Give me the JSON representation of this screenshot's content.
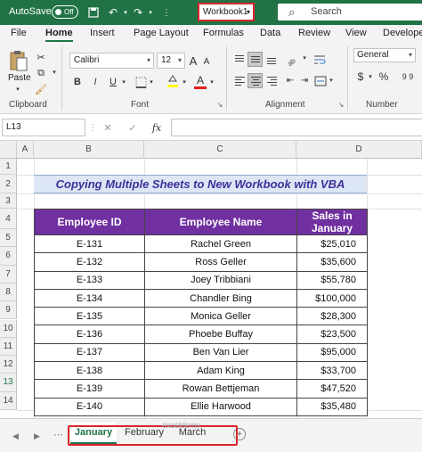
{
  "titlebar": {
    "autosave_label": "AutoSave",
    "toggle_state": "Off",
    "workbook_name": "Workbook1",
    "search_placeholder": "Search"
  },
  "ribbon_tabs": [
    "File",
    "Home",
    "Insert",
    "Page Layout",
    "Formulas",
    "Data",
    "Review",
    "View",
    "Develope"
  ],
  "ribbon": {
    "paste_label": "Paste",
    "clipboard_group": "Clipboard",
    "font_name": "Calibri",
    "font_size": "12",
    "font_group": "Font",
    "bold": "B",
    "italic": "I",
    "underline": "U",
    "grow_font": "A",
    "shrink_font": "A",
    "fill_color_letter": "A",
    "alignment_group": "Alignment",
    "number_format": "General",
    "currency_symbol": "$",
    "percent_symbol": "%",
    "number_group": "Number"
  },
  "formula_bar": {
    "name_box": "L13",
    "cancel_symbol": "✕",
    "enter_symbol": "✓",
    "fx_symbol": "fx",
    "content": ""
  },
  "columns": [
    "A",
    "B",
    "C",
    "D"
  ],
  "rows": [
    "1",
    "2",
    "3",
    "4",
    "5",
    "6",
    "7",
    "8",
    "9",
    "10",
    "11",
    "12",
    "13",
    "14"
  ],
  "sheet_title": "Copying Multiple Sheets to New Workbook with VBA",
  "table": {
    "headers": [
      "Employee ID",
      "Employee Name",
      "Sales in January"
    ],
    "rows": [
      [
        "E-131",
        "Rachel Green",
        "$25,010"
      ],
      [
        "E-132",
        "Ross Geller",
        "$35,600"
      ],
      [
        "E-133",
        "Joey Tribbiani",
        "$55,780"
      ],
      [
        "E-134",
        "Chandler Bing",
        "$100,000"
      ],
      [
        "E-135",
        "Monica Geller",
        "$28,300"
      ],
      [
        "E-136",
        "Phoebe Buffay",
        "$23,500"
      ],
      [
        "E-137",
        "Ben Van Lier",
        "$95,000"
      ],
      [
        "E-138",
        "Adam King",
        "$33,700"
      ],
      [
        "E-139",
        "Rowan Bettjeman",
        "$47,520"
      ],
      [
        "E-140",
        "Ellie Harwood",
        "$35,480"
      ]
    ]
  },
  "sheet_tabs": [
    "January",
    "February",
    "March"
  ],
  "add_sheet_symbol": "+",
  "watermark": "exceldemy",
  "colors": {
    "excel_green": "#217346",
    "header_purple": "#7030a0",
    "title_text": "#3f2f9a",
    "title_fill": "#dce6f4",
    "highlight_red": "#d9262c"
  }
}
